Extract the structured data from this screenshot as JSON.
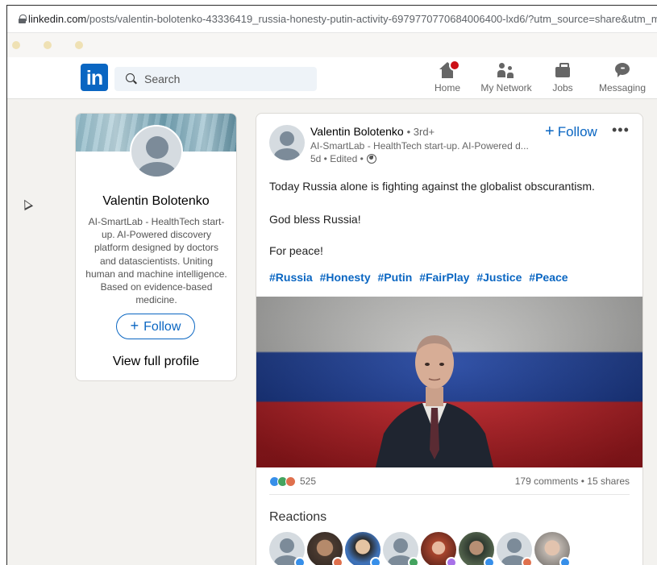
{
  "browser": {
    "url_host": "linkedin.com",
    "url_path": "/posts/valentin-bolotenko-43336419_russia-honesty-putin-activity-6979770770684006400-lxd6/?utm_source=share&utm_me"
  },
  "nav": {
    "logo": "in",
    "search_placeholder": "Search",
    "items": [
      {
        "label": "Home",
        "icon": "home-icon"
      },
      {
        "label": "My Network",
        "icon": "network-icon"
      },
      {
        "label": "Jobs",
        "icon": "jobs-icon"
      },
      {
        "label": "Messaging",
        "icon": "messaging-icon"
      }
    ]
  },
  "profile_card": {
    "name": "Valentin Bolotenko",
    "description": "AI-SmartLab - HealthTech start-up. AI-Powered discovery platform designed by doctors and datascientists. Uniting human and machine intelligence. Based on evidence-based medicine.",
    "follow_label": "Follow",
    "view_profile_label": "View full profile"
  },
  "post": {
    "author": "Valentin Bolotenko",
    "degree": "• 3rd+",
    "headline": "AI-SmartLab - HealthTech start-up. AI-Powered d...",
    "time": "5d • Edited •",
    "follow_label": "Follow",
    "more_label": "•••",
    "lines": [
      "Today Russia alone is fighting against the globalist obscurantism.",
      "God bless Russia!",
      "For peace!"
    ],
    "hashtags": [
      "#Russia",
      "#Honesty",
      "#Putin",
      "#FairPlay",
      "#Justice",
      "#Peace"
    ],
    "reaction_count": "525",
    "comments_shares": "179 comments • 15 shares",
    "reactions_title": "Reactions"
  },
  "colors": {
    "brand": "#0a66c2",
    "page_bg": "#f3f2ef",
    "flag_white": "#d0d0ce",
    "flag_blue": "#1b3d98",
    "flag_red": "#c6242a"
  }
}
